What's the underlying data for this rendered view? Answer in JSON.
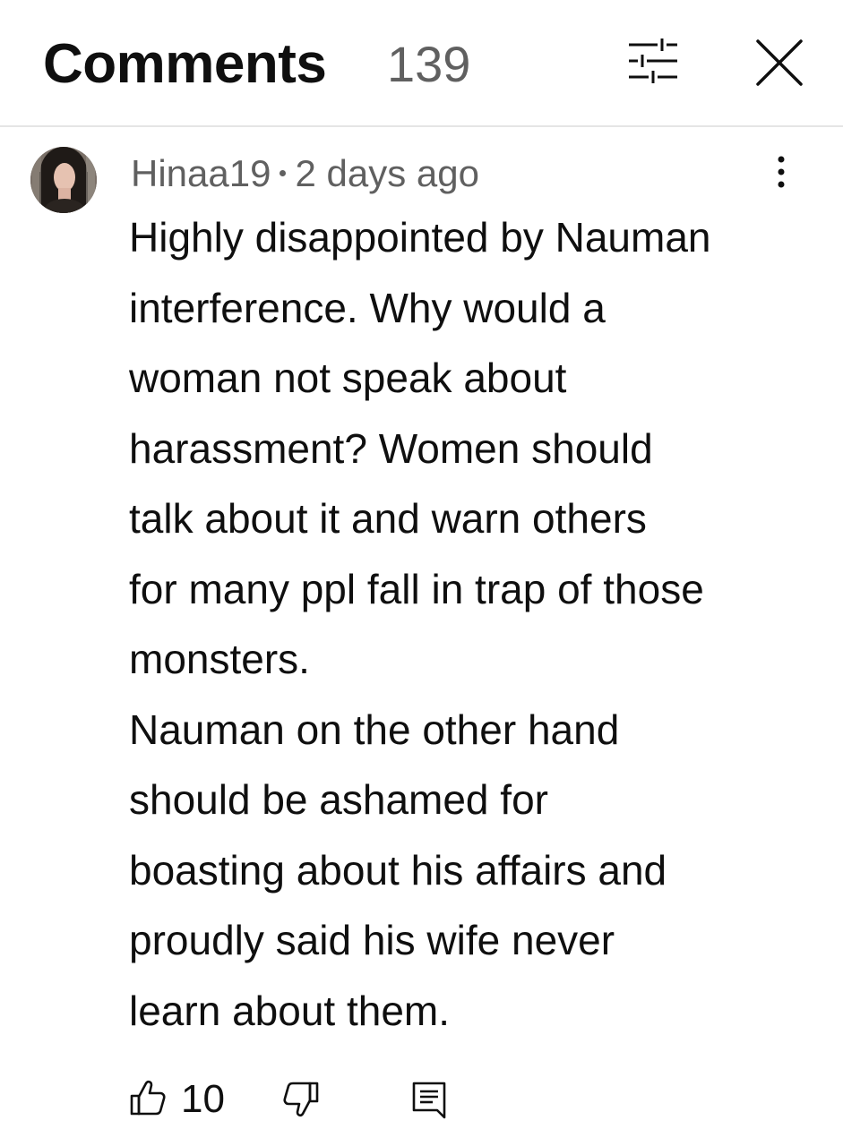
{
  "header": {
    "title": "Comments",
    "count": "139"
  },
  "comment": {
    "author": "Hinaa19",
    "timestamp": "2 days ago",
    "body_lines": [
      "Highly disappointed by Nauman",
      "interference. Why would a",
      "woman not speak about",
      "harassment? Women should",
      "talk about it and warn others",
      "for many ppl fall in trap of those",
      "monsters.",
      "Nauman on the other hand",
      "should be ashamed for",
      "boasting about his affairs and",
      "proudly said his wife never",
      "learn about them."
    ],
    "like_count": "10"
  },
  "icons": {
    "filter": "filter-sliders-icon",
    "close": "close-icon",
    "more": "more-vert-icon",
    "like": "thumbs-up-icon",
    "dislike": "thumbs-down-icon",
    "reply": "reply-comment-icon"
  },
  "colors": {
    "primary_text": "#0f0f0f",
    "secondary_text": "#606060",
    "divider": "#e5e5e5",
    "background": "#ffffff"
  }
}
